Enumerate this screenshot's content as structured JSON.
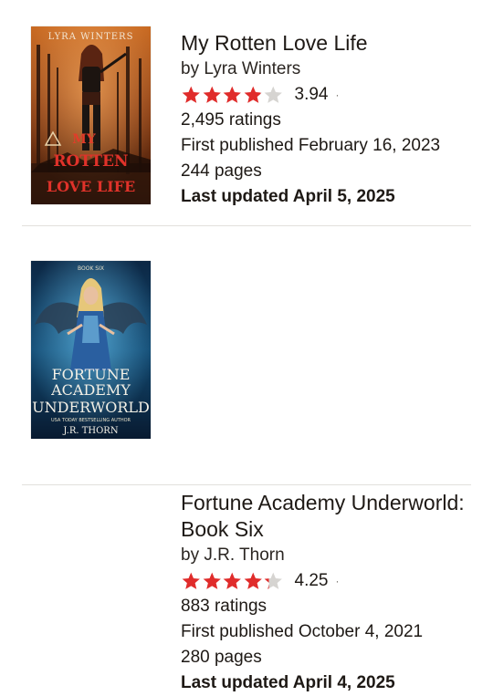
{
  "books": [
    {
      "title": "My Rotten Love Life",
      "author": "by Lyra Winters",
      "rating": 3.94,
      "rating_text": "3.94",
      "rating_sep": "·",
      "ratings_count": "2,495 ratings",
      "first_published": "First published February 16, 2023",
      "pages": "244 pages",
      "last_updated": "Last updated April 5, 2025",
      "cover": {
        "author_text": "LYRA WINTERS",
        "title_line1": "MY",
        "title_line2": "ROTTEN",
        "title_line3": "LOVE LIFE"
      }
    },
    {
      "title": "Fortune Academy Underworld: Book Six",
      "author": "by J.R. Thorn",
      "rating": 4.25,
      "rating_text": "4.25",
      "rating_sep": "·",
      "ratings_count": "883 ratings",
      "first_published": "First published October 4, 2021",
      "pages": "280 pages",
      "last_updated": "Last updated April 4, 2025",
      "cover": {
        "series_text": "BOOK SIX",
        "title_line1": "FORTUNE",
        "title_line2": "ACADEMY",
        "title_line3": "UNDERWORLD",
        "tagline": "USA TODAY BESTSELLING AUTHOR",
        "author_text": "J.R. THORN"
      }
    }
  ],
  "colors": {
    "star_filled": "#e02c2b",
    "star_empty": "#d6d4d1",
    "text": "#1e1915"
  },
  "icons": [
    "star-icon"
  ]
}
